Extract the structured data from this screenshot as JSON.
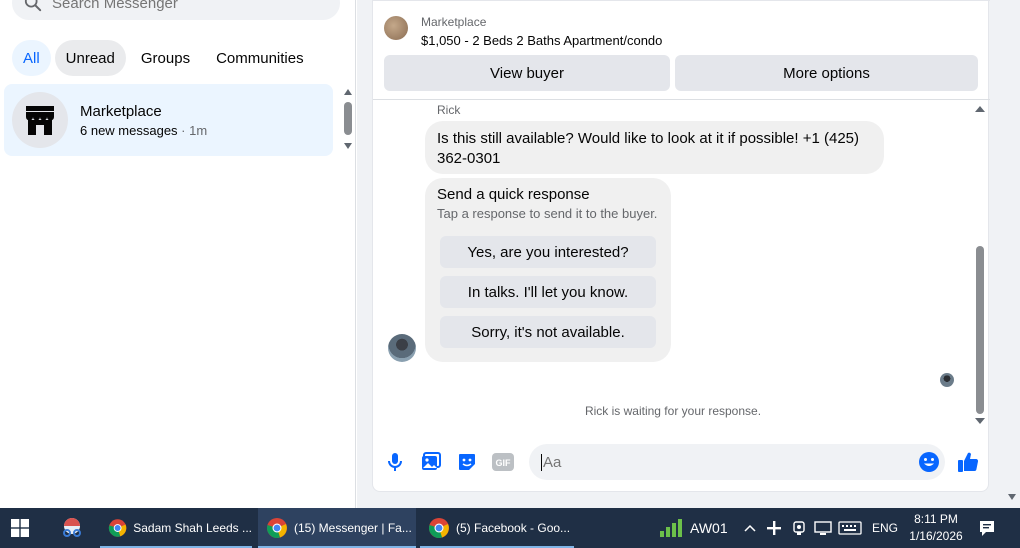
{
  "sidebar": {
    "search_placeholder": "Search Messenger",
    "filters": [
      "All",
      "Unread",
      "Groups",
      "Communities"
    ],
    "conversation": {
      "name": "Marketplace",
      "preview": "6 new messages",
      "time": " · 1m"
    }
  },
  "listing": {
    "label": "Marketplace",
    "title": "$1,050 - 2 Beds 2 Baths Apartment/condo",
    "view_buyer": "View buyer",
    "more_options": "More options"
  },
  "chat": {
    "sender": "Rick",
    "message_line1": "Is this still available? Would like to look at it if possible! +1 (425)",
    "message_line2": "362-0301",
    "quick_title": "Send a quick response",
    "quick_subtitle": "Tap a response to send it to the buyer.",
    "quick_responses": [
      "Yes, are you interested?",
      "In talks. I'll let you know.",
      "Sorry, it's not available."
    ],
    "waiting": "Rick is waiting for your response.",
    "composer_placeholder": "Aa",
    "accent": "#0866ff"
  },
  "taskbar": {
    "apps": [
      {
        "title": "Sadam Shah Leeds ..."
      },
      {
        "title": "(15) Messenger | Fa..."
      },
      {
        "title": "(5) Facebook - Goo..."
      }
    ],
    "network_label": "AW01",
    "language": "ENG",
    "time": "8:11 PM",
    "date": "1/16/2026"
  }
}
